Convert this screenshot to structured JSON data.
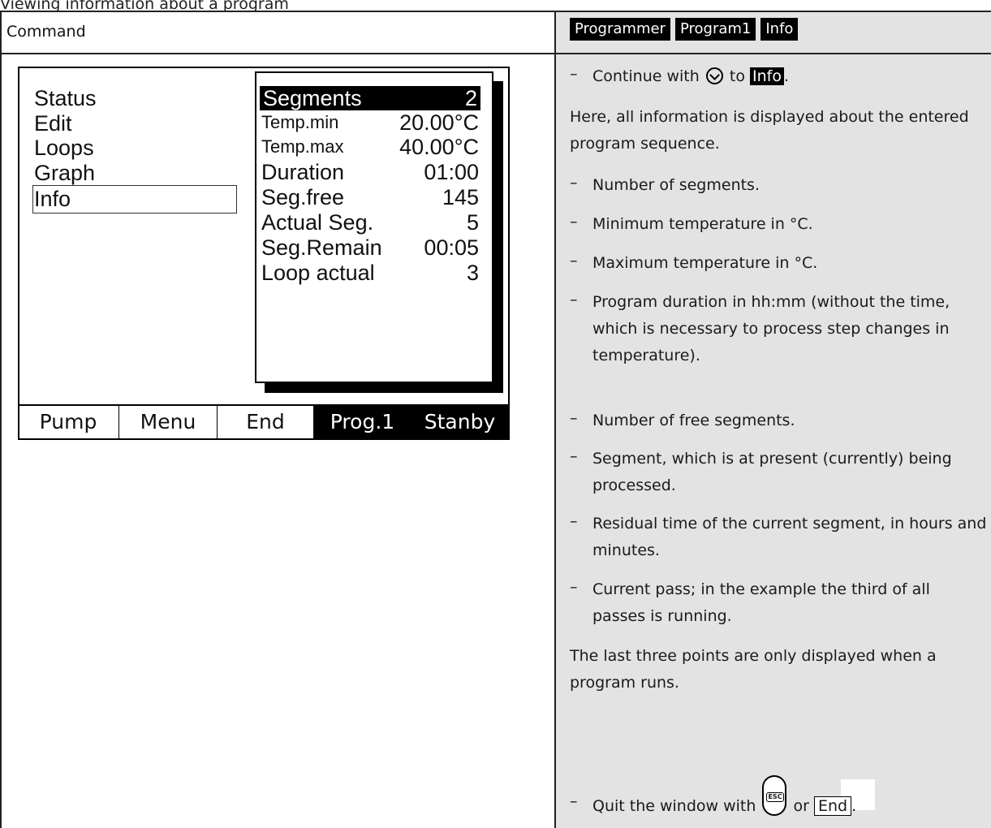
{
  "page_caption": "Viewing information about a program",
  "left_header": "Command",
  "breadcrumb": [
    "Programmer",
    "Program1",
    "Info"
  ],
  "screen": {
    "menu": [
      "Status",
      "Edit",
      "Loops",
      "Graph",
      "Info"
    ],
    "selected_menu": "Info",
    "info_rows": [
      {
        "label": "Segments",
        "value": "2"
      },
      {
        "label": "Temp.min",
        "value": "20.00°C"
      },
      {
        "label": "Temp.max",
        "value": "40.00°C"
      },
      {
        "label": "Duration",
        "value": "01:00"
      },
      {
        "label": "Seg.free",
        "value": "145"
      },
      {
        "label": "Actual Seg.",
        "value": "5"
      },
      {
        "label": "Seg.Remain",
        "value": "00:05"
      },
      {
        "label": "Loop actual",
        "value": "3"
      }
    ],
    "softkeys": [
      "Pump",
      "Menu",
      "End",
      "Prog.1",
      "Stanby"
    ]
  },
  "instructions": {
    "continue_prefix": "Continue with",
    "continue_to": "to",
    "continue_target": "Info",
    "continue_suffix": ".",
    "intro": "Here, all information is displayed about the entered program sequence.",
    "bullets": [
      "Number of segments.",
      "Minimum temperature in °C.",
      "Maximum temperature in °C.",
      "Program duration in hh:mm (without the time, which is necessary to process step changes in temperature).",
      "Number of free segments.",
      "Segment, which is at present (currently) being processed.",
      "Residual time of the current segment, in hours and minutes.",
      "Current pass; in the example the third of all passes is running."
    ],
    "note": "The last three points are only displayed when a program runs.",
    "quit_prefix": "Quit the window with",
    "quit_or": "or",
    "quit_key": "End",
    "quit_suffix": ".",
    "esc_label": "ESC",
    "dash": "–"
  }
}
